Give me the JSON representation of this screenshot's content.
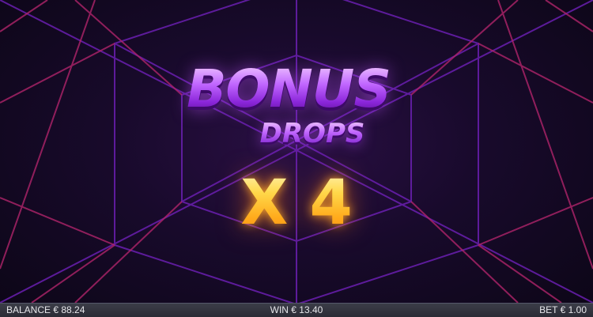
{
  "title": {
    "line1": "BONUS",
    "line2": "DROPS"
  },
  "multiplier": "X 4",
  "status_bar": {
    "balance": "BALANCE € 88.24",
    "win": "WIN € 13.40",
    "bet": "BET € 1.00"
  },
  "colors": {
    "background": "#12081f",
    "grid_lines_magenta": "#b0246a",
    "grid_lines_violet": "#6a1fb0",
    "title_purple": "#c167ff",
    "multiplier_gold": "#ffb21e",
    "status_bar": "#2f303a"
  }
}
